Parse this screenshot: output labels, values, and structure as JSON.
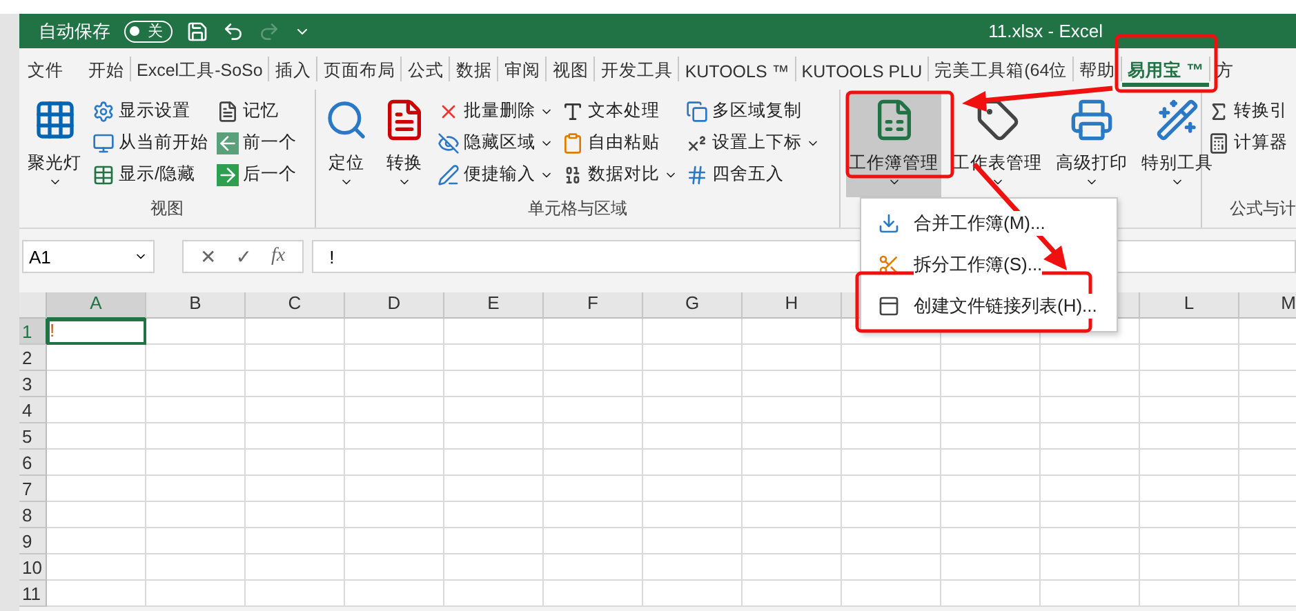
{
  "title_bar": {
    "autosave_label": "自动保存",
    "autosave_toggle": {
      "text": "关",
      "on": false
    },
    "redo_disabled": true,
    "title": "11.xlsx  -  Excel"
  },
  "tabs": [
    {
      "label": "文件",
      "selected": false
    },
    {
      "label": "开始",
      "selected": false
    },
    {
      "label": "Excel工具-SoSo",
      "selected": false
    },
    {
      "label": "插入",
      "selected": false
    },
    {
      "label": "页面布局",
      "selected": false
    },
    {
      "label": "公式",
      "selected": false
    },
    {
      "label": "数据",
      "selected": false
    },
    {
      "label": "审阅",
      "selected": false
    },
    {
      "label": "视图",
      "selected": false
    },
    {
      "label": "开发工具",
      "selected": false
    },
    {
      "label": "KUTOOLS ™",
      "selected": false
    },
    {
      "label": "KUTOOLS PLU",
      "selected": false
    },
    {
      "label": "完美工具箱(64位",
      "selected": false
    },
    {
      "label": "帮助",
      "selected": false
    },
    {
      "label": "易用宝 ™",
      "selected": true
    },
    {
      "label": "方",
      "selected": false
    }
  ],
  "ribbon_groups": [
    {
      "label": "视图",
      "large": [
        {
          "label": "聚光灯",
          "caret": true,
          "selected": false
        }
      ],
      "columns": [
        [
          {
            "label": "显示设置",
            "caret": false
          },
          {
            "label": "从当前开始",
            "caret": false
          },
          {
            "label": "显示/隐藏",
            "caret": false
          }
        ],
        [
          {
            "label": "记忆",
            "caret": false
          },
          {
            "label": "前一个",
            "caret": false
          },
          {
            "label": "后一个",
            "caret": false
          }
        ]
      ]
    },
    {
      "label": "单元格与区域",
      "large": [
        {
          "label": "定位",
          "caret": true,
          "selected": false
        },
        {
          "label": "转换",
          "caret": true,
          "selected": false
        }
      ],
      "columns": [
        [
          {
            "label": "批量删除",
            "caret": true
          },
          {
            "label": "隐藏区域",
            "caret": true
          },
          {
            "label": "便捷输入",
            "caret": true
          }
        ],
        [
          {
            "label": "文本处理",
            "caret": false
          },
          {
            "label": "自由粘贴",
            "caret": false
          },
          {
            "label": "数据对比",
            "caret": true
          }
        ],
        [
          {
            "label": "多区域复制",
            "caret": false
          },
          {
            "label": "设置上下标",
            "caret": true
          },
          {
            "label": "四舍五入",
            "caret": false
          }
        ]
      ]
    },
    {
      "large": [
        {
          "label": "工作簿管理",
          "caret": true,
          "selected": true
        },
        {
          "label": "工作表管理",
          "caret": true,
          "selected": false
        },
        {
          "label": "高级打印",
          "caret": true,
          "selected": false
        },
        {
          "label": "特别工具",
          "caret": true,
          "selected": false
        }
      ]
    },
    {
      "label": "公式与计",
      "columns": [
        [
          {
            "label": "转换引",
            "caret": false
          },
          {
            "label": "计算器",
            "caret": false
          }
        ]
      ]
    }
  ],
  "formula_bar": {
    "name_box": "A1",
    "cancel": "✕",
    "enter": "✓",
    "function": "fx",
    "value": "!"
  },
  "grid": {
    "columns": [
      {
        "label": "A",
        "selected": true
      },
      {
        "label": "B",
        "selected": false
      },
      {
        "label": "C",
        "selected": false
      },
      {
        "label": "D",
        "selected": false
      },
      {
        "label": "E",
        "selected": false
      },
      {
        "label": "F",
        "selected": false
      },
      {
        "label": "G",
        "selected": false
      },
      {
        "label": "H",
        "selected": false
      },
      {},
      {},
      {},
      {
        "label": "L",
        "selected": false
      },
      {
        "label": "M",
        "selected": false
      }
    ],
    "rows": [
      {
        "label": "1",
        "selected": true,
        "cells": [
          {
            "value": "!",
            "selected": true
          }
        ]
      },
      {
        "label": "2",
        "selected": false
      },
      {
        "label": "3",
        "selected": false
      },
      {
        "label": "4",
        "selected": false
      },
      {
        "label": "5",
        "selected": false
      },
      {
        "label": "6",
        "selected": false
      },
      {
        "label": "7",
        "selected": false
      },
      {
        "label": "8",
        "selected": false
      },
      {
        "label": "9",
        "selected": false
      },
      {
        "label": "10",
        "selected": false
      },
      {
        "label": "11",
        "selected": false
      }
    ]
  },
  "dropdown_menu": {
    "items": [
      {
        "label": "合并工作簿(M)..."
      },
      {
        "label": "拆分工作簿(S)..."
      },
      {
        "label": "创建文件链接列表(H)..."
      }
    ]
  }
}
